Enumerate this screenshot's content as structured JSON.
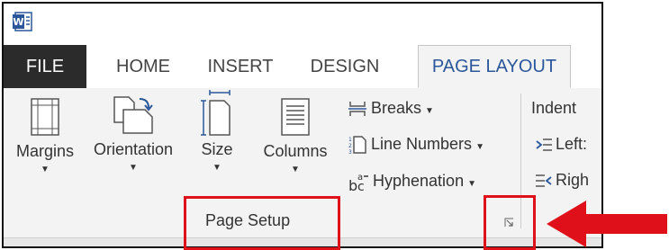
{
  "app": {
    "name": "Word"
  },
  "tabs": [
    "FILE",
    "HOME",
    "INSERT",
    "DESIGN",
    "PAGE LAYOUT"
  ],
  "active_tab": "PAGE LAYOUT",
  "page_setup": {
    "group_label": "Page Setup",
    "large_buttons": [
      "Margins",
      "Orientation",
      "Size",
      "Columns"
    ],
    "small_buttons": [
      "Breaks",
      "Line Numbers",
      "Hyphenation"
    ]
  },
  "paragraph": {
    "indent_label": "Indent",
    "left_label": "Left:",
    "right_label": "Righ"
  },
  "colors": {
    "file_tab_bg": "#2b2b2b",
    "accent": "#2b579a",
    "highlight": "#e0101a",
    "arrow": "#e0101a"
  },
  "icons": [
    "word-logo-icon",
    "margins-icon",
    "orientation-icon",
    "size-icon",
    "columns-icon",
    "breaks-icon",
    "line-numbers-icon",
    "hyphenation-icon",
    "indent-left-icon",
    "indent-right-icon",
    "dialog-launcher-icon",
    "red-arrow"
  ]
}
